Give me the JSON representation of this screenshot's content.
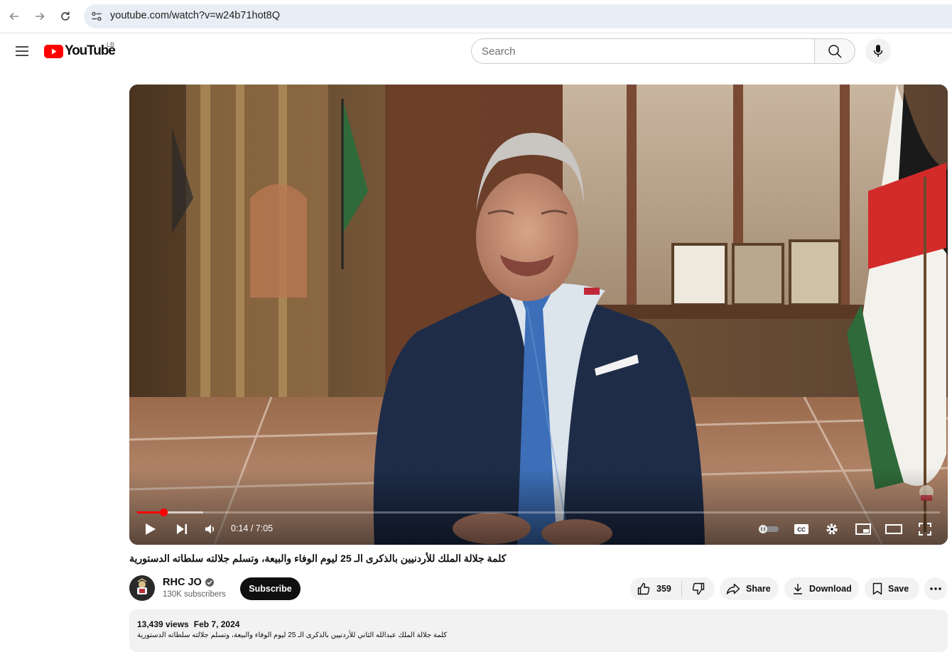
{
  "browser": {
    "url": "youtube.com/watch?v=w24b71hot8Q",
    "icons": [
      "back-arrow-icon",
      "forward-arrow-icon",
      "reload-icon",
      "site-info-icon"
    ]
  },
  "header": {
    "logo_text": "YouTube",
    "country_code": "LB",
    "search_placeholder": "Search",
    "search_value": "",
    "icons": [
      "menu-icon",
      "search-icon",
      "mic-icon"
    ]
  },
  "player": {
    "time_current": "0:14",
    "time_separator": " / ",
    "time_total": "7:05",
    "progress_fraction": 0.033,
    "buffered_fraction": 0.082,
    "autoplay": "off",
    "icons": [
      "play-icon",
      "next-icon",
      "volume-icon",
      "autoplay-toggle-icon",
      "captions-icon",
      "settings-icon",
      "miniplayer-icon",
      "theater-mode-icon",
      "fullscreen-icon"
    ]
  },
  "video": {
    "title": "كلمة جلالة الملك للأردنيين بالذكرى الـ 25 ليوم الوفاء والبيعة، وتسلم جلالته سلطاته الدستورية",
    "channel_name": "RHC JO",
    "verified": true,
    "subscribers": "130K subscribers",
    "subscribe_label": "Subscribe",
    "likes": "359",
    "share_label": "Share",
    "download_label": "Download",
    "save_label": "Save"
  },
  "description": {
    "views": "13,439 views",
    "date": "Feb 7, 2024",
    "text": "كلمة جلالة الملك عبدالله الثاني للأردنيين بالذكرى الـ 25 ليوم الوفاء والبيعة، وتسلم جلالته سلطاته الدستورية"
  },
  "colors": {
    "brand_red": "#ff0000",
    "subscribe_bg": "#0f0f0f",
    "pill_bg": "#f2f2f2",
    "omnibox_bg": "#e9eef6"
  }
}
